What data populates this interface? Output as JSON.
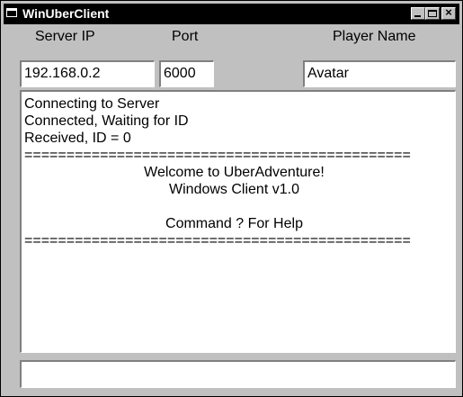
{
  "window": {
    "title": "WinUberClient",
    "minimize_label": "_",
    "maximize_label": "□",
    "close_label": "×"
  },
  "labels": {
    "server_ip": "Server IP",
    "port": "Port",
    "player_name": "Player Name"
  },
  "fields": {
    "server_ip": "192.168.0.2",
    "port": "6000",
    "player_name": "Avatar"
  },
  "output": {
    "lines": [
      "Connecting to Server",
      "Connected, Waiting for ID",
      "Received, ID = 0",
      "==============================================",
      "Welcome to UberAdventure!",
      "Windows Client v1.0",
      "",
      "Command ? For Help",
      "=============================================="
    ]
  },
  "command_input": {
    "value": ""
  }
}
